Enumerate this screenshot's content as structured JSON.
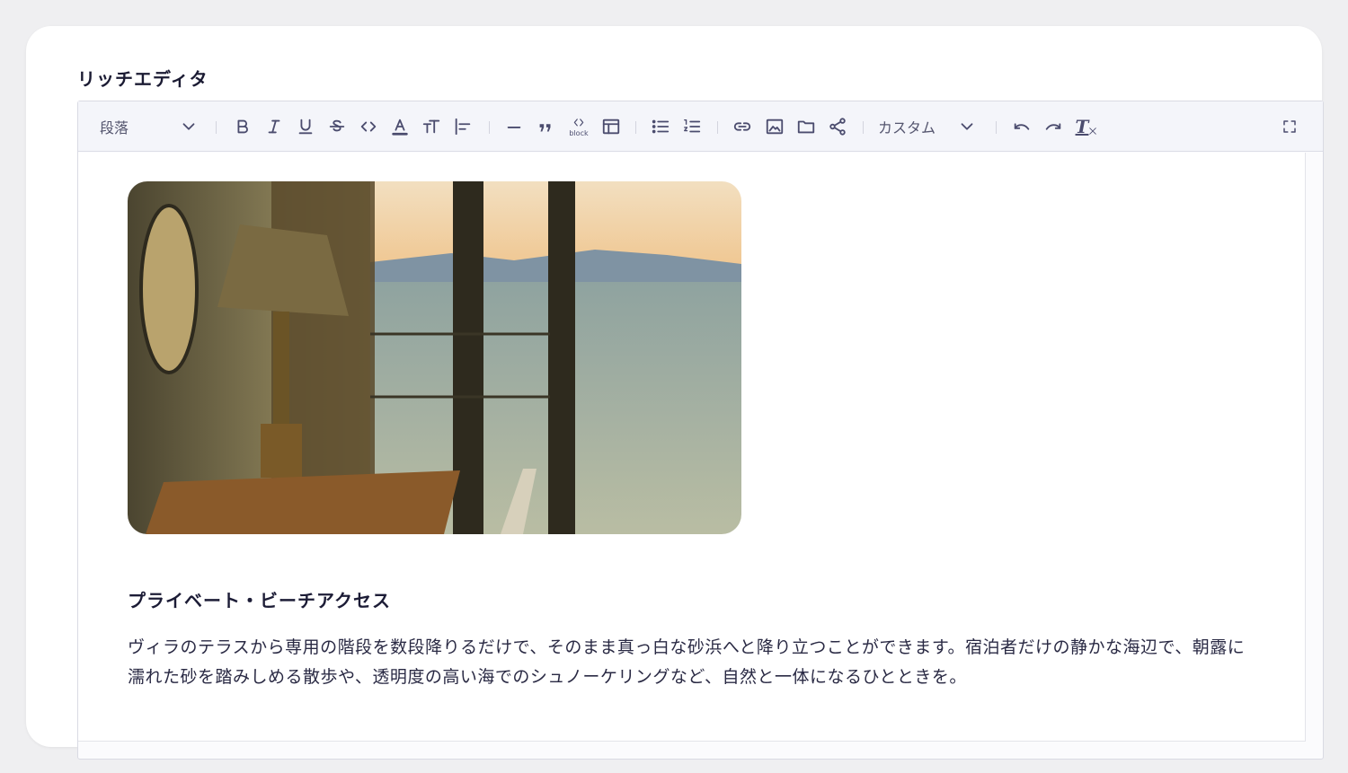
{
  "card": {
    "title": "リッチエディタ"
  },
  "toolbar": {
    "block_format": {
      "selected": "段落"
    },
    "font_style": {
      "selected": "カスタム"
    },
    "code_block_sublabel": "block",
    "clear_format_glyph": "T"
  },
  "content": {
    "image": {
      "alt_description_icon": "photo",
      "subject": "lamp-window-sea"
    },
    "heading": "プライベート・ビーチアクセス",
    "paragraph": "ヴィラのテラスから専用の階段を数段降りるだけで、そのまま真っ白な砂浜へと降り立つことができます。宿泊者だけの静かな海辺で、朝露に濡れた砂を踏みしめる散歩や、透明度の高い海でのシュノーケリングなど、自然と一体になるひとときを。"
  },
  "colors": {
    "accent_text": "#1b1b33",
    "icon": "#4b4c6e",
    "toolbar_bg": "#f4f5fa"
  }
}
